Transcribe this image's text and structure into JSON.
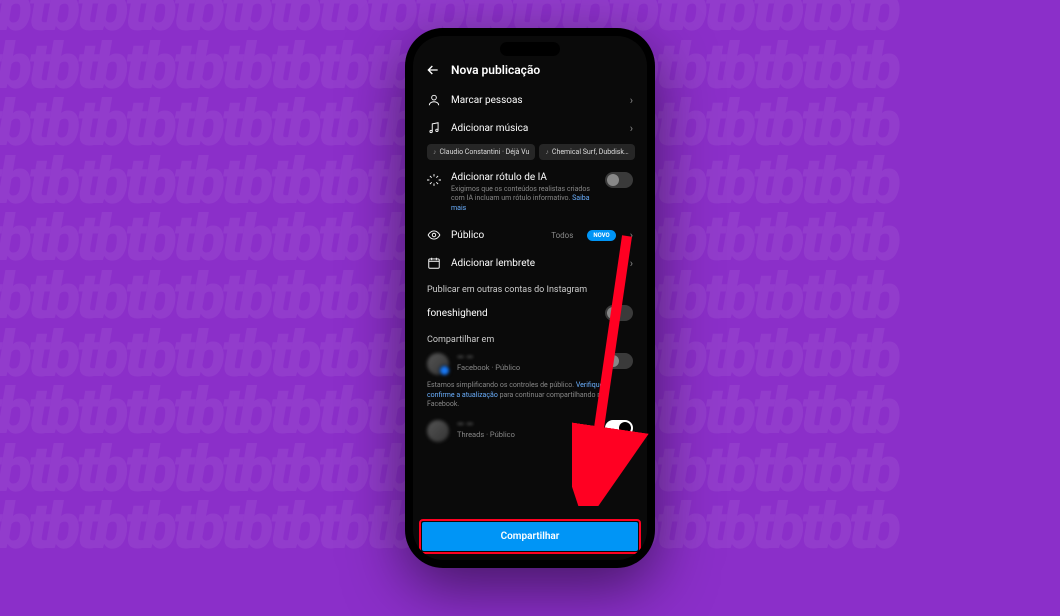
{
  "header": {
    "title": "Nova publicação"
  },
  "tag_people": {
    "label": "Marcar pessoas"
  },
  "add_music": {
    "label": "Adicionar música"
  },
  "music_chips": [
    "Claudio Constantini · Déjà Vu",
    "Chemical Surf, Dubdisk…"
  ],
  "ai": {
    "title": "Adicionar rótulo de IA",
    "desc": "Exigimos que os conteúdos realistas criados com IA incluam um rótulo informativo. ",
    "link": "Saiba mais"
  },
  "audience": {
    "label": "Público",
    "value": "Todos",
    "badge": "NOVO"
  },
  "reminder": {
    "label": "Adicionar lembrete"
  },
  "publish_other": {
    "label": "Publicar em outras contas do Instagram"
  },
  "account": {
    "name": "foneshighend"
  },
  "share_in": {
    "label": "Compartilhar em"
  },
  "fb": {
    "name": "— —",
    "sub": "Facebook · Público",
    "desc1": "Estamos simplificando os controles de público. ",
    "link1": "Verifique e confirme a atualização",
    "desc2": " para continuar compartilhando no Facebook."
  },
  "threads": {
    "name": "— —",
    "sub": "Threads · Público"
  },
  "share_btn": {
    "label": "Compartilhar"
  }
}
